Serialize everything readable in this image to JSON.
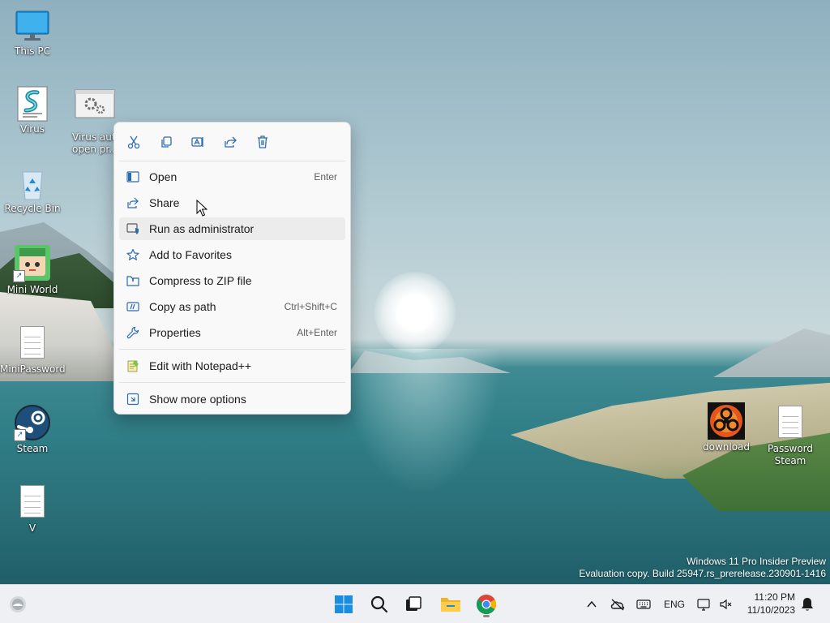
{
  "desktop": {
    "icons": [
      {
        "label": "This PC"
      },
      {
        "label": "Virus"
      },
      {
        "label": "Virus auto open pr..."
      },
      {
        "label": "Recycle Bin"
      },
      {
        "label": "Mini World"
      },
      {
        "label": "MiniPassword"
      },
      {
        "label": "Steam"
      },
      {
        "label": "V"
      },
      {
        "label": "download"
      },
      {
        "label": "Password Steam"
      }
    ]
  },
  "context_menu": {
    "toolbar": [
      {
        "icon": "cut-icon"
      },
      {
        "icon": "copy-icon"
      },
      {
        "icon": "rename-icon"
      },
      {
        "icon": "share-icon"
      },
      {
        "icon": "delete-icon"
      }
    ],
    "items": [
      {
        "label": "Open",
        "shortcut": "Enter",
        "icon": "open-icon"
      },
      {
        "label": "Share",
        "shortcut": "",
        "icon": "share-icon"
      },
      {
        "label": "Run as administrator",
        "shortcut": "",
        "icon": "shield-icon"
      },
      {
        "label": "Add to Favorites",
        "shortcut": "",
        "icon": "star-icon"
      },
      {
        "label": "Compress to ZIP file",
        "shortcut": "",
        "icon": "zip-icon"
      },
      {
        "label": "Copy as path",
        "shortcut": "Ctrl+Shift+C",
        "icon": "path-icon"
      },
      {
        "label": "Properties",
        "shortcut": "Alt+Enter",
        "icon": "wrench-icon"
      },
      {
        "label": "Edit with Notepad++",
        "shortcut": "",
        "icon": "notepadpp-icon"
      },
      {
        "label": "Show more options",
        "shortcut": "",
        "icon": "more-options-icon"
      }
    ]
  },
  "watermark": {
    "line1": "Windows 11 Pro Insider Preview",
    "line2": "Evaluation copy. Build 25947.rs_prerelease.230901-1416"
  },
  "taskbar": {
    "language": "ENG",
    "time": "11:20 PM",
    "date": "11/10/2023"
  },
  "colors": {
    "accent": "#2b6cb0",
    "menu_bg": "#f9f9f9",
    "taskbar_bg": "#eef0f3"
  }
}
